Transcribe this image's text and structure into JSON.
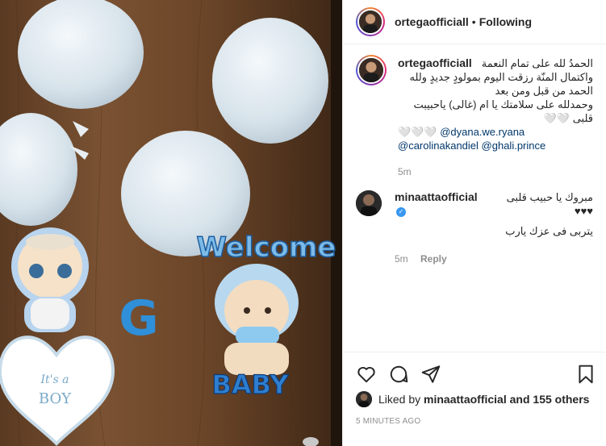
{
  "post": {
    "username": "ortegaofficiall",
    "follow_status": "Following",
    "separator": "•"
  },
  "caption": {
    "username": "ortegaofficiall",
    "line1": "الحمدُ لله على تمام النعمة",
    "line2": "واكتمال المنّة رزقت اليوم بمولودٍ جديدٍ ولله الحمد من قبل ومن بعد",
    "line3": "وحمدلله على سلامتك يا ام (غالى) ياحبيبت قلبى 🤍🤍",
    "line4_prefix": "🤍🤍🤍",
    "mention1": "@dyana.we.ryana",
    "mention2": "@carolinakandiel",
    "mention3": "@ghali.prince",
    "time": "5m"
  },
  "comment": {
    "username": "minaattaofficial",
    "verified_glyph": "✓",
    "line1": "مبروك يا حبيب قلبى ♥♥♥",
    "line2": "يتربى فى عزك يارب",
    "time": "5m",
    "reply_label": "Reply"
  },
  "likes": {
    "prefix": "Liked by",
    "user": "minaattaofficial",
    "suffix": "and 155 others"
  },
  "timestamp": "5 MINUTES AGO",
  "photo": {
    "letter": "G",
    "welcome_text": "Welcome",
    "baby_text": "BABY",
    "card_text_1": "It's a",
    "card_text_2": "BOY"
  },
  "icons": {
    "like": "heart-icon",
    "comment": "comment-icon",
    "share": "share-icon",
    "save": "bookmark-icon"
  }
}
